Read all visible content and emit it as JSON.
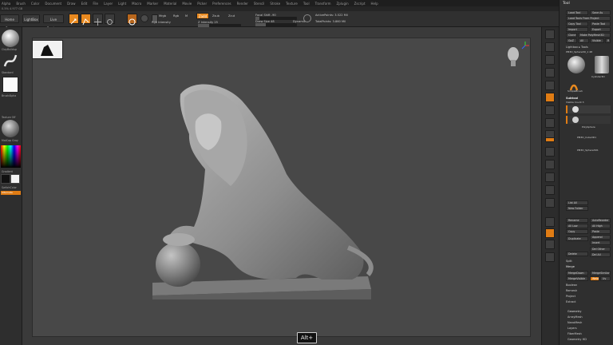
{
  "menu": [
    "Alpha",
    "Brush",
    "Color",
    "Document",
    "Draw",
    "Edit",
    "File",
    "Layer",
    "Light",
    "Macro",
    "Marker",
    "Material",
    "Movie",
    "Picker",
    "Preferences",
    "Render",
    "Stencil",
    "Stroke",
    "Texture",
    "Tool",
    "Transform",
    "Zplugin",
    "Zscript",
    "Help"
  ],
  "info": "0.5% 4.977 GB",
  "toolbar": {
    "home_page": "Home Page",
    "lightbox": "LightBox",
    "live_boolean": "Live Boolean",
    "mrgb": "Mrgb",
    "rgb": "Rgb",
    "m": "M",
    "zadd": "Zadd",
    "zsub": "Zsub",
    "zcut": "Zcut",
    "focal_shift": "Focal Shift -90",
    "rgb_intensity": "Rgb Intensity",
    "z_intensity": "Z Intensity 25",
    "draw_size": "Draw Size 48",
    "dynamic": "Dynamic",
    "active_points": "ActivePoints: 3.522 Mil",
    "total_points": "TotalPoints: 3.860 Mil"
  },
  "left_shelf": {
    "clay_buildup": "ClayBuildup",
    "standard": "Standard",
    "brush_alpha": "BrushAlpha",
    "texture_off": "Texture Off",
    "matcap": "MatCap Gray",
    "gradient": "Gradient",
    "switch_color": "SwitchColor",
    "alternate": "Alternate"
  },
  "alt_key": "Alt+",
  "right_panel": {
    "title": "Tool",
    "load_tool": "Load Tool",
    "save_as": "Save As",
    "load_tools_from_project": "Load Tools From Project",
    "copy_tool": "Copy Tool",
    "paste_tool": "Paste Tool",
    "import": "Import",
    "export": "Export",
    "clone": "Clone",
    "make_polymesh": "Make PolyMesh3D",
    "goz": "GoZ",
    "all": "All",
    "visible": "Visible",
    "r": "R",
    "lightbox_tools": "Lightbox ▸ Tools",
    "pm3d_label": "PM3D_Sphere3D_1 48",
    "simple_brush": "SimpleBrush",
    "cylinder": "Cylinder3D",
    "subtool": "Subtool",
    "visible_count": "Visible Count 3",
    "polysphere": "PolySphere",
    "pm3d_cube": "PM3D_Cube3D1",
    "pm3d_sphere": "PM3D_Sphere3D1",
    "list_all": "List All",
    "new_folder": "New Folder",
    "rename": "Rename",
    "autoreorder": "AutoReorder",
    "all_low": "All Low",
    "all_high": "All High",
    "copy": "Copy",
    "paste": "Paste",
    "duplicate": "Duplicate",
    "append": "Append",
    "insert": "Insert",
    "del_other": "Del Other",
    "delete": "Delete",
    "del_all": "Del All",
    "split": "Split",
    "merge": "Merge",
    "merge_down": "MergeDown",
    "merge_similar": "MergeSimilar",
    "merge_visible": "MergeVisible",
    "weld": "Weld",
    "uv": "Uv",
    "boolean": "Boolean",
    "remesh": "Remesh",
    "project": "Project",
    "extract": "Extract",
    "geometry": "Geometry",
    "array_mesh": "ArrayMesh",
    "nano_mesh": "NanoMesh",
    "layers": "Layers",
    "fiber_mesh": "FiberMesh",
    "geometry_hd": "Geometry HD"
  }
}
